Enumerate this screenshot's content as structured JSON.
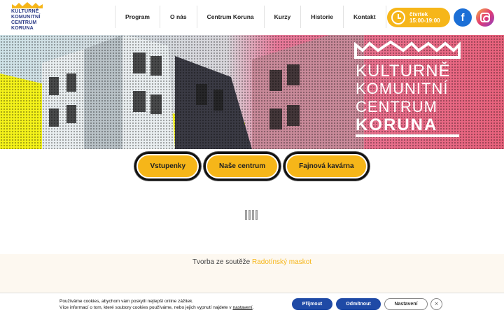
{
  "logo": {
    "lines": [
      "KULTURNĚ",
      "KOMUNITNÍ",
      "CENTRUM",
      "KORUNA"
    ]
  },
  "nav": {
    "items": [
      "Program",
      "O nás",
      "Centrum Koruna",
      "Kurzy",
      "Historie",
      "Kontakt"
    ]
  },
  "hours": {
    "day": "čtvrtek",
    "time": "15:00-19:00"
  },
  "social": {
    "facebook_glyph": "f"
  },
  "hero": {
    "title_lines": [
      "KULTURNĚ",
      "KOMUNITNÍ",
      "CENTRUM",
      "KORUNA"
    ]
  },
  "buttons": [
    "Vstupenky",
    "Naše centrum",
    "Fajnová kavárna"
  ],
  "band": {
    "text": "Tvorba ze soutěže ",
    "link": "Radotínský maskot"
  },
  "cookie": {
    "line1": "Používáme cookies, abychom vám poskytli nejlepší online zážitek.",
    "line2": "Více informací o tom, které soubory cookies používáme, nebo jejich vypnutí najdete v ",
    "link": "nastavení",
    "line2_end": ".",
    "accept": "Přijmout",
    "reject": "Odmítnout",
    "settings": "Nastavení",
    "close": "×"
  },
  "colors": {
    "accent": "#f6b619",
    "navy": "#1f4aa6",
    "hero_pink": "#e8627c",
    "hero_yellow": "#f4f21a"
  }
}
